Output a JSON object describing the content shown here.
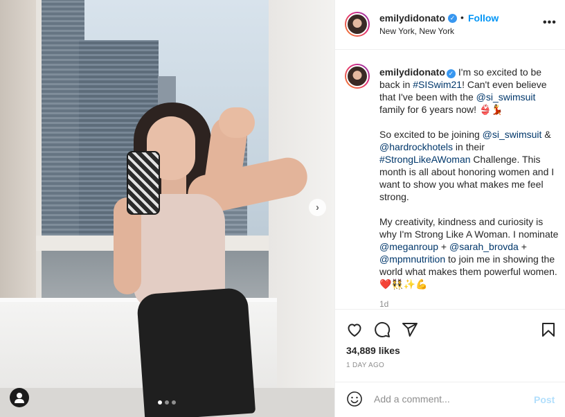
{
  "header": {
    "username": "emilydidonato",
    "separator": "•",
    "follow_label": "Follow",
    "location": "New York, New York",
    "more_label": "•••"
  },
  "caption": {
    "username": "emilydidonato",
    "p1": {
      "t1": "I'm so excited to be back in ",
      "tag1": "#SISwim21",
      "t2": "! Can't even believe that I've been with the ",
      "mention1": "@si_swimsuit",
      "t3": " family for 6 years now! 👙💃"
    },
    "p2": {
      "t1": "So excited to be joining ",
      "mention1": "@si_swimsuit",
      "t2": " & ",
      "mention2": "@hardrockhotels",
      "t3": " in their ",
      "tag1": "#StrongLikeAWoman",
      "t4": " Challenge. This month is all about honoring women and I want to show you what makes me feel strong."
    },
    "p3": {
      "t1": "My creativity, kindness and curiosity is why I'm Strong Like A Woman. I nominate ",
      "mention1": "@meganroup",
      "t2": " + ",
      "mention2": "@sarah_brovda",
      "t3": " + ",
      "mention3": "@mpmnutrition",
      "t4": " to join me in showing the world  what makes them powerful women. ❤️👯✨💪"
    },
    "time_ago": "1d"
  },
  "actions": {
    "likes": "34,889 likes",
    "date": "1 DAY AGO"
  },
  "add_comment": {
    "placeholder": "Add a comment...",
    "post_label": "Post"
  },
  "colors": {
    "link": "#00376b",
    "follow": "#0095f6",
    "verified": "#3897f0",
    "post_disabled": "#b2dffc",
    "muted": "#8e8e8e"
  },
  "icons": [
    "next-arrow-icon",
    "tag-people-icon",
    "verified-badge-icon",
    "more-options-icon",
    "heart-icon",
    "comment-icon",
    "share-icon",
    "bookmark-icon",
    "emoji-icon"
  ]
}
